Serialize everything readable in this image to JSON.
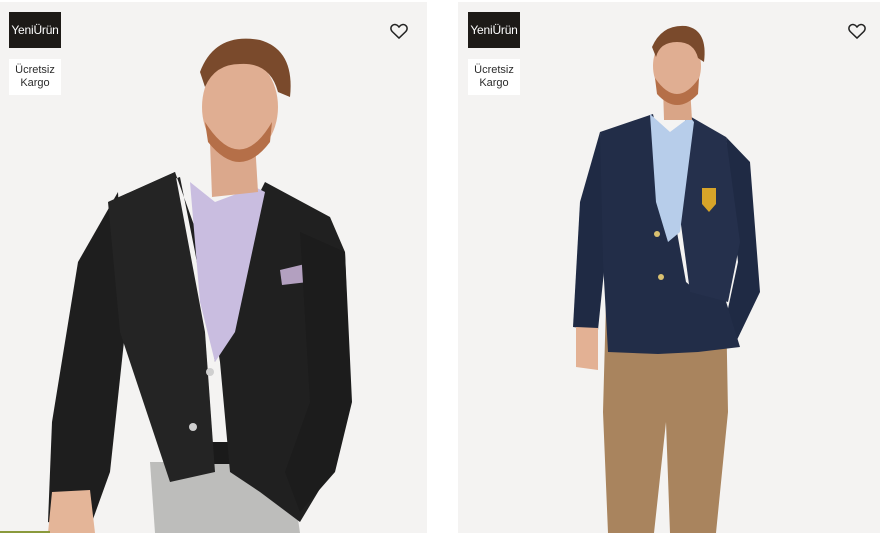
{
  "products": [
    {
      "badge_new": "YeniÜrün",
      "badge_shipping_line1": "Ücretsiz",
      "badge_shipping_line2": "Kargo",
      "favorite_icon": "heart-outline-icon",
      "photo_alt": "Black blazer with lilac shirt"
    },
    {
      "badge_new": "YeniÜrün",
      "badge_shipping_line1": "Ücretsiz",
      "badge_shipping_line2": "Kargo",
      "favorite_icon": "heart-outline-icon",
      "photo_alt": "Navy blazer with crest and khaki trousers"
    }
  ],
  "colors": {
    "card_bg": "#f4f3f2",
    "badge_dark": "#1d1a17"
  }
}
